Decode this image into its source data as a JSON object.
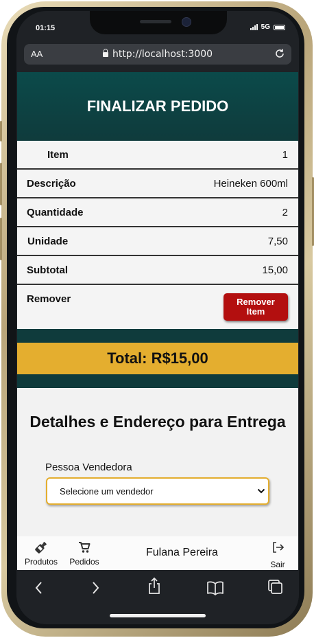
{
  "status_bar": {
    "time": "01:15",
    "network": "5G"
  },
  "browser": {
    "text_size_label": "AA",
    "url": "http://localhost:3000"
  },
  "page": {
    "title": "FINALIZAR PEDIDO",
    "rows": [
      {
        "label": "Item",
        "value": "1"
      },
      {
        "label": "Descrição",
        "value": "Heineken 600ml"
      },
      {
        "label": "Quantidade",
        "value": "2"
      },
      {
        "label": "Unidade",
        "value": "7,50"
      },
      {
        "label": "Subtotal",
        "value": "15,00"
      }
    ],
    "remove_label": "Remover",
    "remove_button": "Remover Item",
    "total": "Total: R$15,00",
    "details_title": "Detalhes e Endereço para Entrega",
    "seller_label": "Pessoa Vendedora",
    "seller_select": "Selecione um vendedor"
  },
  "navbar": {
    "products": "Produtos",
    "orders": "Pedidos",
    "user": "Fulana Pereira",
    "logout": "Sair"
  },
  "colors": {
    "header": "#0f3b3c",
    "accent": "#e4ae2f",
    "danger": "#b30f0f"
  },
  "icons": [
    "bottle-icon",
    "cart-icon",
    "logout-icon",
    "back-icon",
    "forward-icon",
    "share-icon",
    "bookmarks-icon",
    "tabs-icon",
    "lock-icon",
    "reload-icon"
  ]
}
